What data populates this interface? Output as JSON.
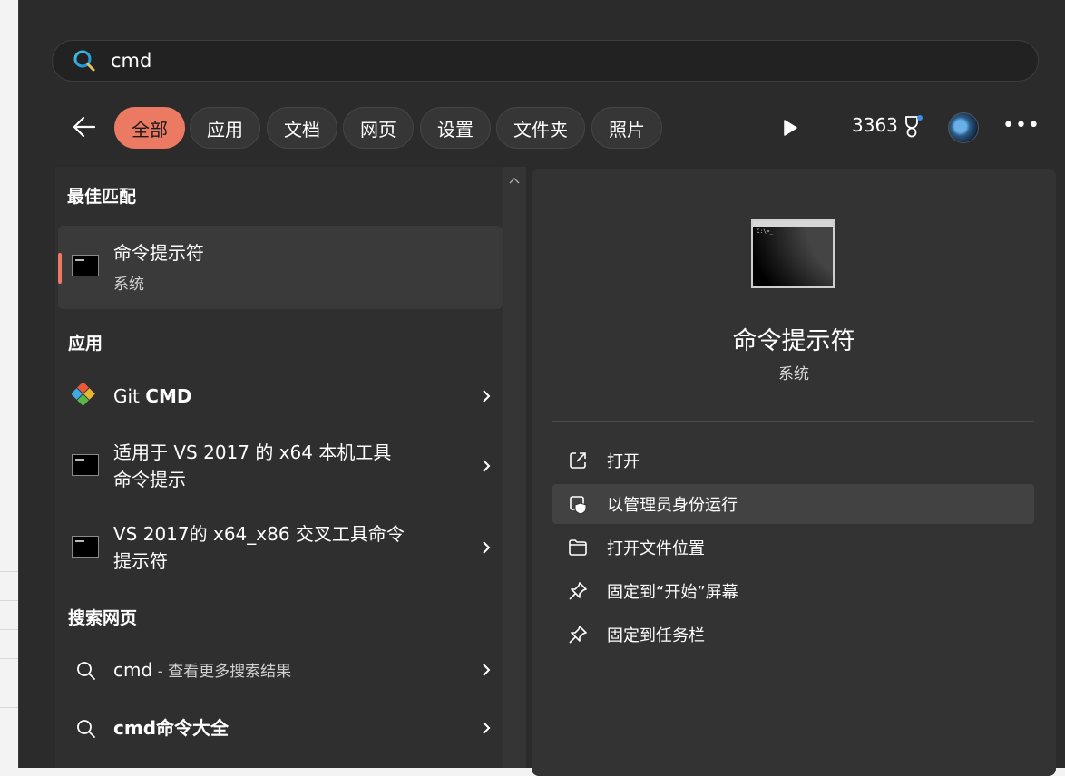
{
  "search": {
    "value": "cmd",
    "placeholder": ""
  },
  "filters": [
    "全部",
    "应用",
    "文档",
    "网页",
    "设置",
    "文件夹",
    "照片"
  ],
  "points": "3363",
  "best_match": {
    "heading": "最佳匹配",
    "name": "命令提示符",
    "type": "系统"
  },
  "apps": {
    "heading": "应用",
    "items": [
      {
        "name_plain": "Git ",
        "name_bold": "CMD"
      },
      {
        "line1": "适用于 VS 2017 的 x64 本机工具",
        "line2": "命令提示"
      },
      {
        "line1": "VS 2017的 x64_x86 交叉工具命令",
        "line2": "提示符"
      }
    ]
  },
  "web": {
    "heading": "搜索网页",
    "items": [
      {
        "term": "cmd",
        "suffix": " - 查看更多搜索结果"
      },
      {
        "term": "cmd命令大全",
        "suffix": ""
      }
    ]
  },
  "detail": {
    "title": "命令提示符",
    "subtitle": "系统",
    "actions": [
      "打开",
      "以管理员身份运行",
      "打开文件位置",
      "固定到“开始”屏幕",
      "固定到任务栏"
    ]
  },
  "icons": {
    "search": "search-icon",
    "back": "back-arrow-icon",
    "play": "play-icon",
    "trophy": "rewards-trophy-icon",
    "more": "more-icon",
    "chevron": "chevron-right-icon"
  },
  "colors": {
    "accent": "#ec7a63",
    "panel": "#2b2b2b"
  }
}
